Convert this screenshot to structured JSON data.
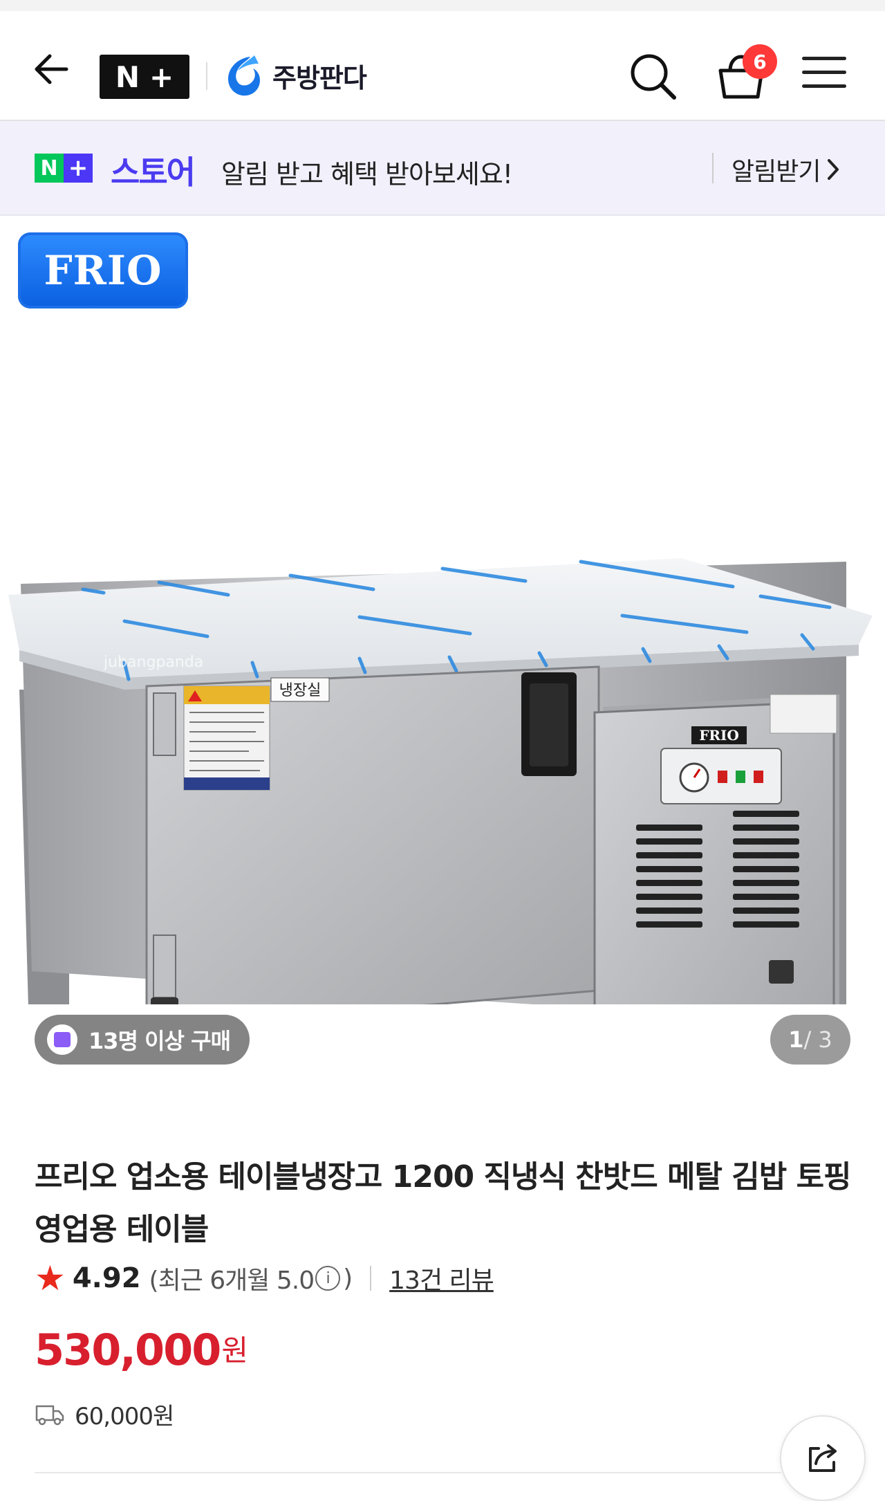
{
  "header": {
    "nplus_logo": [
      "N",
      "+"
    ],
    "brand_name": "주방판다",
    "cart_count": "6"
  },
  "banner": {
    "nplus": [
      "N",
      "+"
    ],
    "store": "스토어",
    "message": "알림 받고 혜택 받아보세요!",
    "cta": "알림받기"
  },
  "product_image": {
    "badge": "FRIO",
    "buyers": "13명 이상 구매",
    "page_current": "1",
    "page_rest": " / 3",
    "label_door": "냉장실",
    "label_panel": "FRIO",
    "watermark": "jubangpanda"
  },
  "product": {
    "title": "프리오 업소용 테이블냉장고 1200 직냉식 찬밧드 메탈 김밥 토핑 영업용 테이블",
    "rating": "4.92",
    "recent_prefix": "(최근 6개월 5.0",
    "recent_suffix": ")",
    "reviews": "13건 리뷰",
    "price": "530,000",
    "price_unit": "원",
    "shipping": "60,000원"
  },
  "colors": {
    "price": "#d81f2e",
    "star": "#e8291c",
    "store": "#4b3bf0",
    "nplus_green": "#03c75a",
    "badge_red": "#ff3838"
  }
}
